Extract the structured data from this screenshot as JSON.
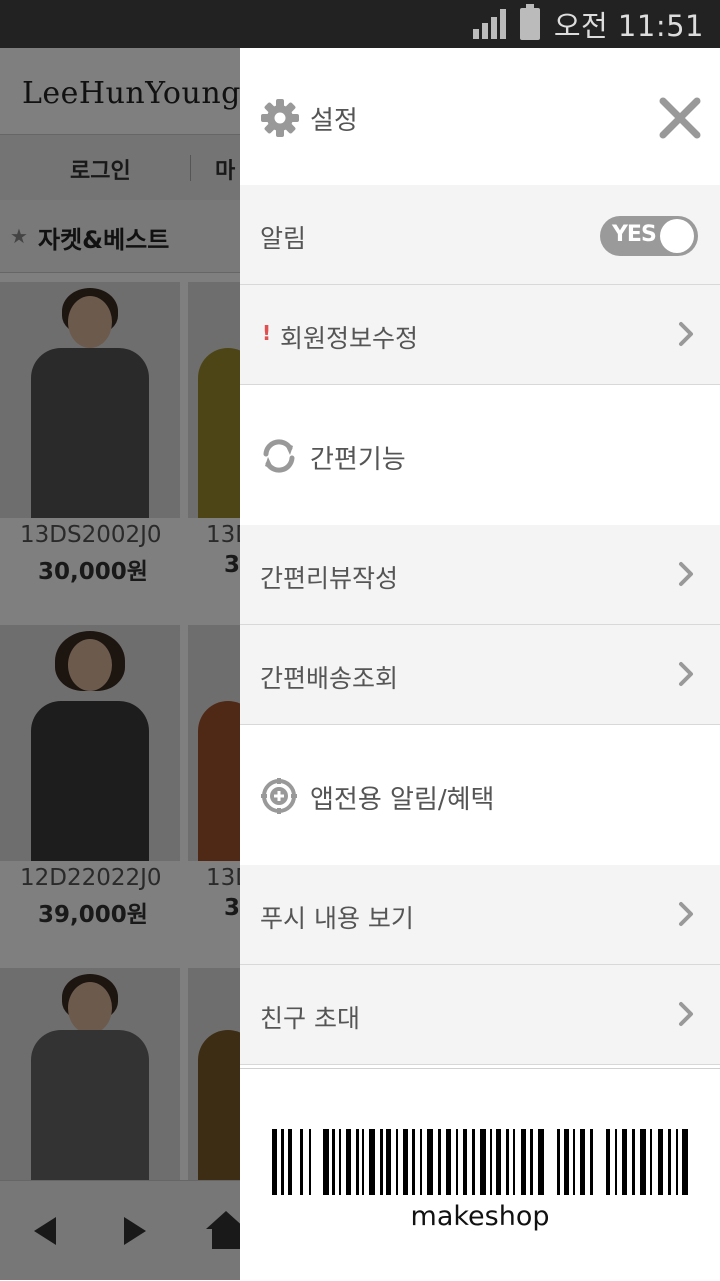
{
  "status_bar": {
    "time": "오전 11:51",
    "signal_icon": "signal-icon",
    "battery_icon": "battery-icon"
  },
  "background": {
    "logo": "LeeHunYoung",
    "login": "로그인",
    "menu_partial": "마",
    "category": "자켓&베스트",
    "products": [
      {
        "code": "13DS2002J0",
        "price": "30,000원"
      },
      {
        "code": "13D",
        "price": "3"
      },
      {
        "code": "12D22022J0",
        "price": "39,000원"
      },
      {
        "code": "13D",
        "price": "3"
      }
    ]
  },
  "panel": {
    "header": {
      "title": "설정",
      "icon": "gear-icon",
      "close_icon": "close-icon"
    },
    "alarm": {
      "label": "알림",
      "toggle": "YES"
    },
    "member_edit": {
      "warn": "!",
      "label": "회원정보수정"
    },
    "easy_section": {
      "label": "간편기능",
      "icon": "refresh-icon"
    },
    "easy_items": [
      {
        "label": "간편리뷰작성"
      },
      {
        "label": "간편배송조회"
      }
    ],
    "app_section": {
      "label": "앱전용 알림/혜택",
      "icon": "target-plus-icon"
    },
    "app_items": [
      {
        "label": "푸시 내용 보기"
      },
      {
        "label": "친구 초대"
      }
    ],
    "barcode": {
      "text": "makeshop"
    }
  },
  "colors": {
    "panel_row_bg": "#f4f4f4",
    "toggle_bg": "#9a9a9a",
    "icon_gray": "#999999",
    "warn_red": "#e05050"
  }
}
